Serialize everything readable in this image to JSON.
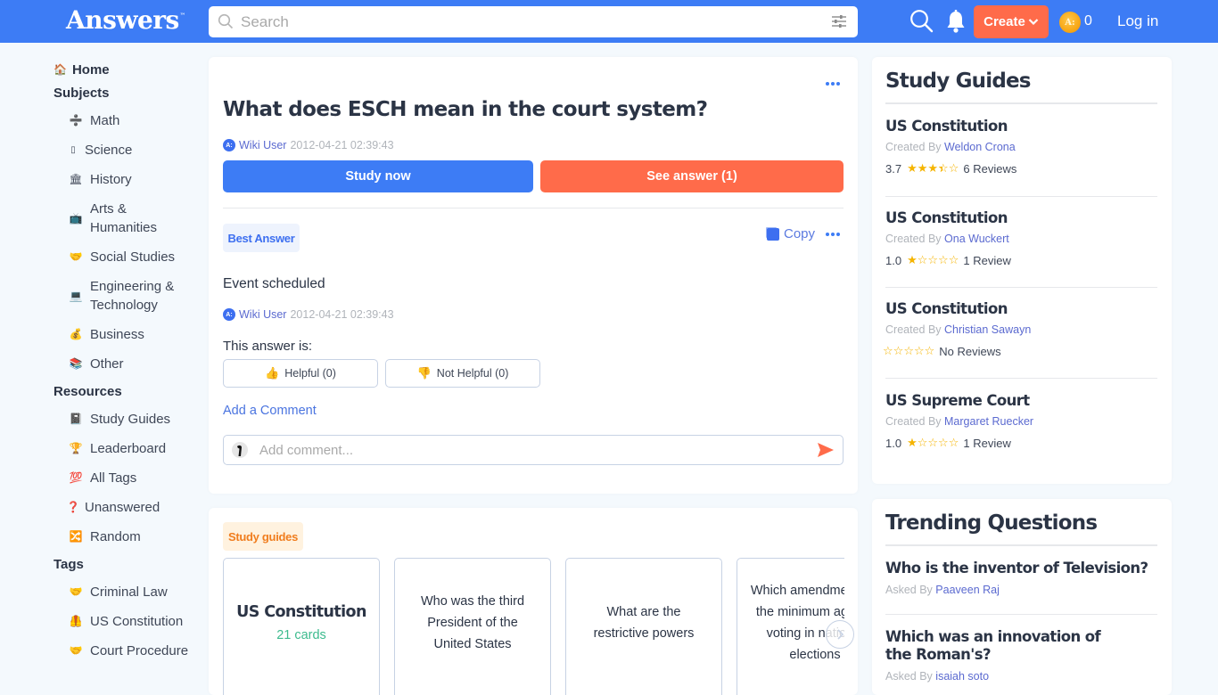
{
  "header": {
    "logo": "Answers",
    "logo_tm": "™",
    "search_placeholder": "Search",
    "create_label": "Create",
    "coin_count": "0",
    "coin_glyph": "A:",
    "login_label": "Log in"
  },
  "sidebar": {
    "home": {
      "label": "Home",
      "icon": "house-icon"
    },
    "sections": [
      {
        "title": "Subjects",
        "items": [
          {
            "label": "Math",
            "icon": "division-icon",
            "glyph": "➗"
          },
          {
            "label": "Science",
            "icon": "science-icon",
            "glyph": "▯"
          },
          {
            "label": "History",
            "icon": "museum-icon",
            "glyph": "🏛"
          },
          {
            "label": "Arts & Humanities",
            "icon": "tv-icon",
            "glyph": "📺"
          },
          {
            "label": "Social Studies",
            "icon": "handshake-icon",
            "glyph": "🤝"
          },
          {
            "label": "Engineering & Technology",
            "icon": "laptop-icon",
            "glyph": "💻"
          },
          {
            "label": "Business",
            "icon": "money-bag-icon",
            "glyph": "💰"
          },
          {
            "label": "Other",
            "icon": "books-icon",
            "glyph": "📚"
          }
        ]
      },
      {
        "title": "Resources",
        "items": [
          {
            "label": "Study Guides",
            "icon": "notebook-icon",
            "glyph": "📓"
          },
          {
            "label": "Leaderboard",
            "icon": "trophy-icon",
            "glyph": "🏆"
          },
          {
            "label": "All Tags",
            "icon": "hundred-icon",
            "glyph": "💯"
          },
          {
            "label": "Unanswered",
            "icon": "question-icon",
            "glyph": "❓"
          },
          {
            "label": "Random",
            "icon": "shuffle-icon",
            "glyph": "🔀"
          }
        ]
      },
      {
        "title": "Tags",
        "items": [
          {
            "label": "Criminal Law",
            "icon": "handshake-icon",
            "glyph": "🤝"
          },
          {
            "label": "US Constitution",
            "icon": "vest-icon",
            "glyph": "🦺"
          },
          {
            "label": "Court Procedure",
            "icon": "handshake-icon",
            "glyph": "🤝"
          }
        ]
      }
    ]
  },
  "question": {
    "title": "What does ESCH mean in the court system?",
    "author": "Wiki User",
    "date": "2012-04-21 02:39:43",
    "study_now": "Study now",
    "see_answer": "See answer (1)"
  },
  "answer": {
    "badge": "Best Answer",
    "copy_label": "Copy",
    "text": "Event scheduled",
    "author": "Wiki User",
    "date": "2012-04-21 02:39:43",
    "rating_prompt": "This answer is:",
    "helpful": "Helpful (0)",
    "not_helpful": "Not Helpful (0)",
    "add_comment_link": "Add a Comment",
    "comment_placeholder": "Add comment..."
  },
  "study_guides_carousel": {
    "badge": "Study guides",
    "items": [
      {
        "title": "US Constitution",
        "subtitle": "21 cards"
      },
      {
        "question": "Who was the third President of the United States"
      },
      {
        "question": "What are the restrictive powers"
      },
      {
        "question": "Which amendment set the minimum age for voting in national elections"
      }
    ]
  },
  "right_study_guides": {
    "title": "Study Guides",
    "created_by_label": "Created By",
    "items": [
      {
        "title": "US Constitution",
        "author": "Weldon Crona",
        "rating": "3.7",
        "rating_value": 3.7,
        "reviews": "6 Reviews"
      },
      {
        "title": "US Constitution",
        "author": "Ona Wuckert",
        "rating": "1.0",
        "rating_value": 1.0,
        "reviews": "1 Review"
      },
      {
        "title": "US Constitution",
        "author": "Christian Sawayn",
        "rating": "",
        "rating_value": 0,
        "reviews": "No Reviews"
      },
      {
        "title": "US Supreme Court",
        "author": "Margaret Ruecker",
        "rating": "1.0",
        "rating_value": 1.0,
        "reviews": "1 Review"
      }
    ]
  },
  "trending": {
    "title": "Trending Questions",
    "asked_by_label": "Asked By",
    "items": [
      {
        "question": "Who is the inventor of Television?",
        "author": "Paaveen Raj"
      },
      {
        "question": "Which was an innovation of the Roman's?",
        "author": "isaiah soto"
      }
    ]
  },
  "colors": {
    "brand_blue": "#3d7cf5",
    "accent_orange": "#ff6b4a",
    "star": "#f5b400",
    "link": "#5b6ad0",
    "cards_green": "#3dbb8e"
  }
}
